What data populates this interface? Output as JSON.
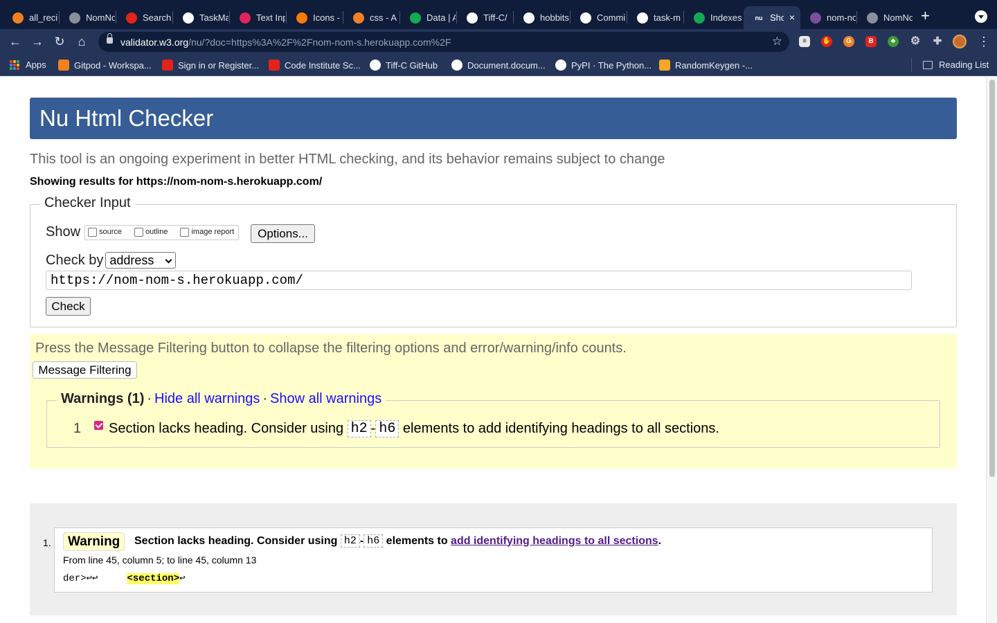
{
  "browser": {
    "tabs": [
      {
        "title": "all_reci",
        "color": "#f38020"
      },
      {
        "title": "NomNo",
        "color": "#8a8f99"
      },
      {
        "title": "Search",
        "color": "#e2231a"
      },
      {
        "title": "TaskMa",
        "color": "#ffffff"
      },
      {
        "title": "Text Inp",
        "color": "#e0245e"
      },
      {
        "title": "Icons -",
        "color": "#ff7a00"
      },
      {
        "title": "css - A",
        "color": "#f48024"
      },
      {
        "title": "Data | A",
        "color": "#13aa52"
      },
      {
        "title": "Tiff-C/",
        "color": "#ffffff"
      },
      {
        "title": "hobbits",
        "color": "#ffffff"
      },
      {
        "title": "Commi",
        "color": "#ffffff"
      },
      {
        "title": "task-m",
        "color": "#ffffff"
      },
      {
        "title": "Indexes",
        "color": "#13aa52"
      },
      {
        "title": "Sho",
        "color": "#25355a",
        "icon_text": "nu"
      },
      {
        "title": "nom-no",
        "color": "#7d4e9e"
      },
      {
        "title": "NomNo",
        "color": "#8a8f99"
      }
    ],
    "active_tab_index": 13,
    "close_icon": "×",
    "new_tab_icon": "+",
    "url_host": "validator.w3.org",
    "url_rest": "/nu/?doc=https%3A%2F%2Fnom-nom-s.herokuapp.com%2F",
    "bookmarks": [
      {
        "label": "Apps",
        "icon": "apps-grid"
      },
      {
        "label": "Gitpod - Workspa...",
        "color": "#f38020"
      },
      {
        "label": "Sign in or Register...",
        "color": "#e2231a"
      },
      {
        "label": "Code Institute Sc...",
        "color": "#e2231a"
      },
      {
        "label": "Tiff-C GitHub",
        "color": "#ffffff"
      },
      {
        "label": "Document.docum...",
        "color": "#ffffff"
      },
      {
        "label": "PyPI · The Python...",
        "color": "#ffffff"
      },
      {
        "label": "RandomKeygen -...",
        "color": "#f5a623"
      }
    ],
    "reading_list": "Reading List"
  },
  "page": {
    "title": "Nu Html Checker",
    "tagline": "This tool is an ongoing experiment in better HTML checking, and its behavior remains subject to change",
    "showing": "Showing results for https://nom-nom-s.herokuapp.com/",
    "checker": {
      "legend": "Checker Input",
      "show_label": "Show",
      "checkboxes": [
        "source",
        "outline",
        "image report"
      ],
      "options_button": "Options...",
      "check_by_label": "Check by",
      "check_by_value": "address",
      "address_value": "https://nom-nom-s.herokuapp.com/",
      "check_button": "Check"
    },
    "filter": {
      "text": "Press the Message Filtering button to collapse the filtering options and error/warning/info counts.",
      "button": "Message Filtering",
      "warnings_title": "Warnings (1)",
      "dot": "·",
      "hide_link": "Hide all warnings",
      "show_link": "Show all warnings",
      "item_number": "1",
      "item_text_before": "Section lacks heading. Consider using",
      "item_tag_1": "h2",
      "item_dash": "-",
      "item_tag_2": "h6",
      "item_text_after": "elements to add identifying headings to all sections."
    },
    "result": {
      "number": "1.",
      "badge": "Warning",
      "msg_before": "Section lacks heading. Consider using",
      "tag_1": "h2",
      "dash": "-",
      "tag_2": "h6",
      "msg_mid": "elements to",
      "link": "add identifying headings to all sections",
      "msg_end": ".",
      "location": "From line 45, column 5; to line 45, column 13",
      "code_before": "der>↩↩     ",
      "code_highlight": "<section>",
      "code_after": "↩"
    }
  }
}
